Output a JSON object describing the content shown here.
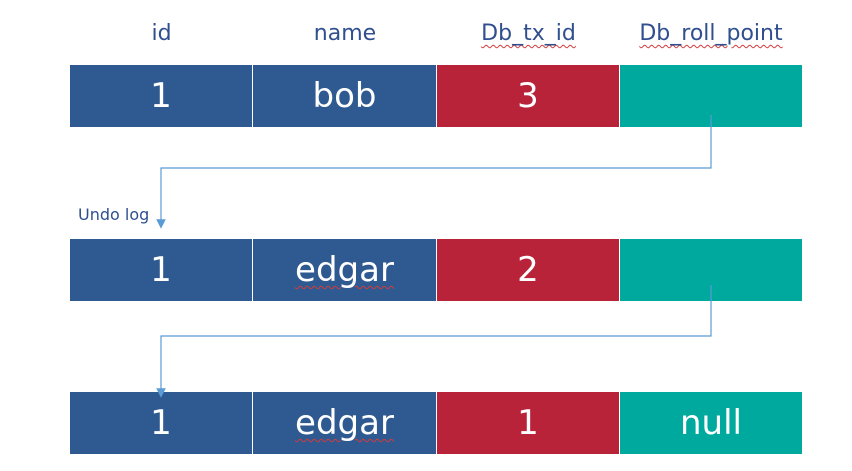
{
  "headers": [
    "id",
    "name",
    "Db_tx_id",
    "Db_roll_point"
  ],
  "undo_label": "Undo log",
  "colors": {
    "id": "#2f5a91",
    "name": "#2f5a91",
    "tx": "#b82339",
    "roll": "#00a99d",
    "header_text": "#2f4f8f",
    "arrow": "#5b9bd5"
  },
  "rows": [
    {
      "id": "1",
      "name": "bob",
      "tx": "3",
      "roll": ""
    },
    {
      "id": "1",
      "name": "edgar",
      "tx": "2",
      "roll": ""
    },
    {
      "id": "1",
      "name": "edgar",
      "tx": "1",
      "roll": "null"
    }
  ]
}
